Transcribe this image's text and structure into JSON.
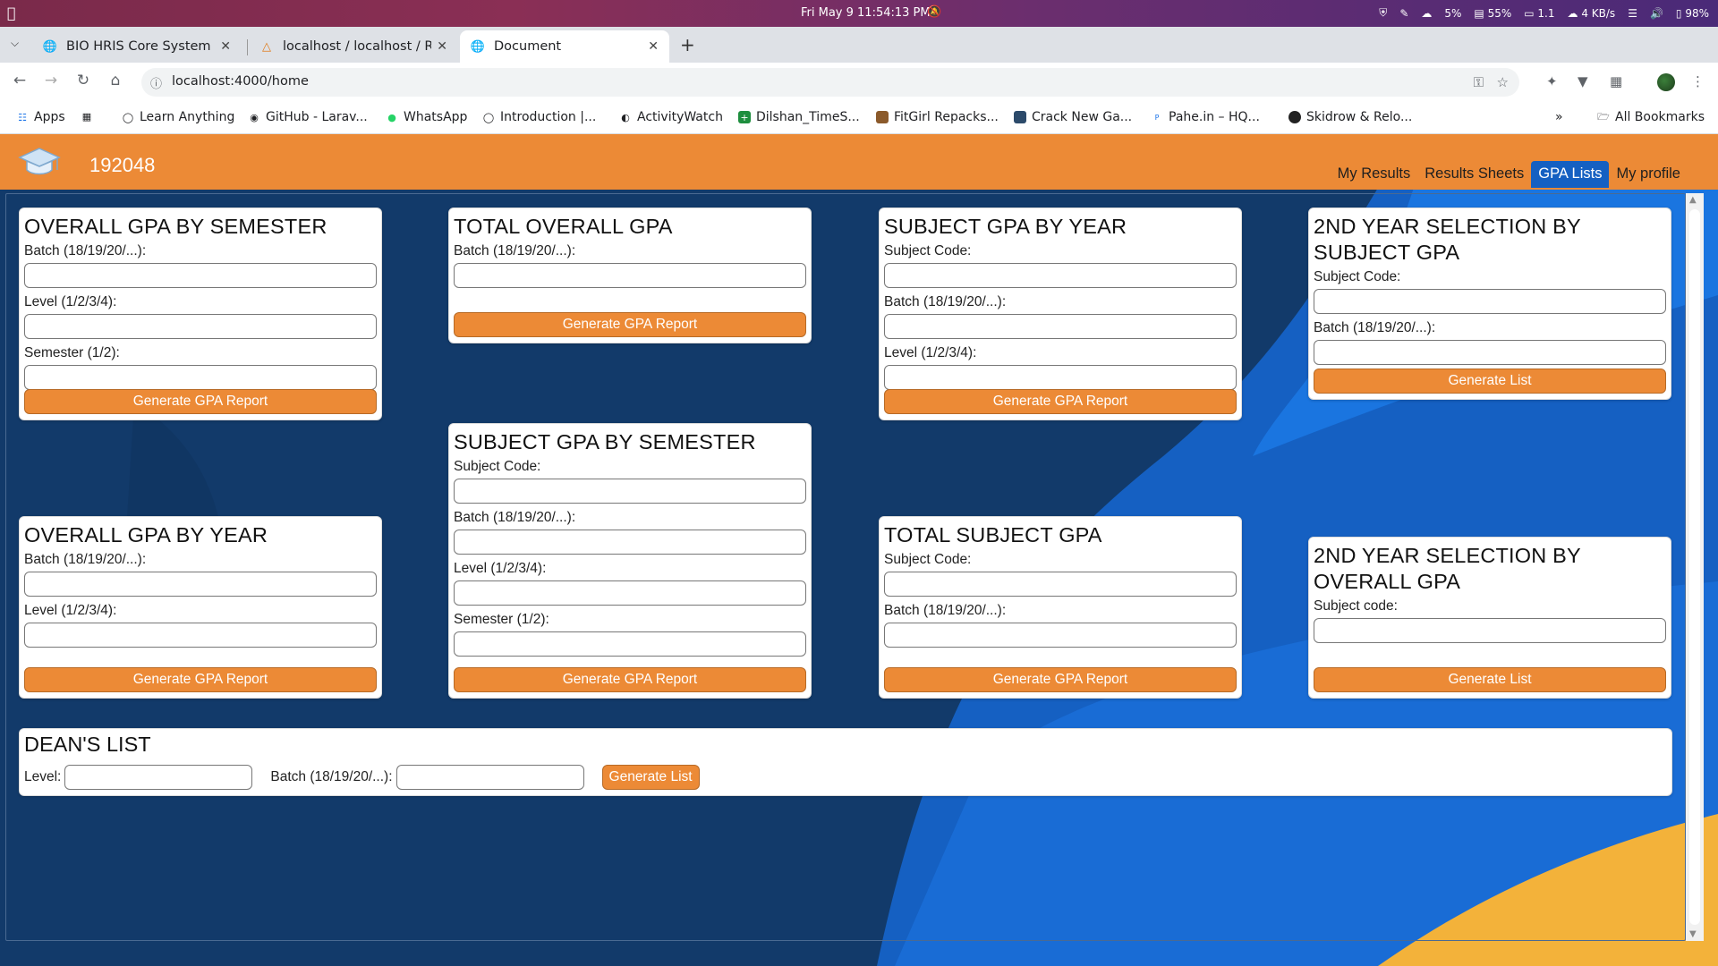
{
  "os": {
    "clock": "Fri May 9  11:54:13 PM",
    "cpu": "5%",
    "battery_status": "55%",
    "monitor": "1.1",
    "network": "4 KB/s",
    "battery": "98%"
  },
  "browser": {
    "tabs": [
      {
        "title": "BIO HRIS Core System",
        "active": false
      },
      {
        "title": "localhost / localhost / RE",
        "active": false
      },
      {
        "title": "Document",
        "active": true
      }
    ],
    "url": "localhost:4000/home",
    "bookmarks": [
      {
        "label": "Apps"
      },
      {
        "label": "Learn Anything"
      },
      {
        "label": "GitHub - Larav..."
      },
      {
        "label": "WhatsApp"
      },
      {
        "label": "Introduction |..."
      },
      {
        "label": "ActivityWatch"
      },
      {
        "label": "Dilshan_TimeS..."
      },
      {
        "label": "FitGirl Repacks..."
      },
      {
        "label": "Crack New Ga..."
      },
      {
        "label": "Pahe.in – HQ..."
      },
      {
        "label": "Skidrow & Relo..."
      }
    ],
    "all_bookmarks": "All Bookmarks"
  },
  "app": {
    "user_id": "192048",
    "nav": [
      {
        "label": "My Results",
        "active": false
      },
      {
        "label": "Results Sheets",
        "active": false
      },
      {
        "label": "GPA Lists",
        "active": true
      },
      {
        "label": "My profile",
        "active": false
      }
    ],
    "accent_color": "#ec8a36",
    "active_nav_color": "#1560c2"
  },
  "cards": {
    "overall_sem": {
      "title": "OVERALL GPA BY SEMESTER",
      "fields": [
        "Batch (18/19/20/...):",
        "Level (1/2/3/4):",
        "Semester (1/2):"
      ],
      "button": "Generate GPA Report"
    },
    "total_overall": {
      "title": "TOTAL OVERALL GPA",
      "fields": [
        "Batch (18/19/20/...):"
      ],
      "button": "Generate GPA Report"
    },
    "subject_year": {
      "title": "SUBJECT GPA BY YEAR",
      "fields": [
        "Subject Code:",
        "Batch (18/19/20/...):",
        "Level (1/2/3/4):"
      ],
      "button": "Generate GPA Report"
    },
    "second_year_subject": {
      "title": "2ND YEAR SELECTION BY SUBJECT GPA",
      "fields": [
        "Subject Code:",
        "Batch (18/19/20/...):"
      ],
      "button": "Generate List"
    },
    "subject_sem": {
      "title": "SUBJECT GPA BY SEMESTER",
      "fields": [
        "Subject Code:",
        "Batch (18/19/20/...):",
        "Level (1/2/3/4):",
        "Semester (1/2):"
      ],
      "button": "Generate GPA Report"
    },
    "overall_year": {
      "title": "OVERALL GPA BY YEAR",
      "fields": [
        "Batch (18/19/20/...):",
        "Level (1/2/3/4):"
      ],
      "button": "Generate GPA Report"
    },
    "total_subject": {
      "title": "TOTAL SUBJECT GPA",
      "fields": [
        "Subject Code:",
        "Batch (18/19/20/...):"
      ],
      "button": "Generate GPA Report"
    },
    "second_year_overall": {
      "title": "2ND YEAR SELECTION BY OVERALL GPA",
      "fields": [
        "Subject code:"
      ],
      "button": "Generate List"
    }
  },
  "deans_list": {
    "title": "DEAN'S LIST",
    "level_label": "Level:",
    "batch_label": "Batch (18/19/20/...):",
    "button": "Generate List"
  }
}
